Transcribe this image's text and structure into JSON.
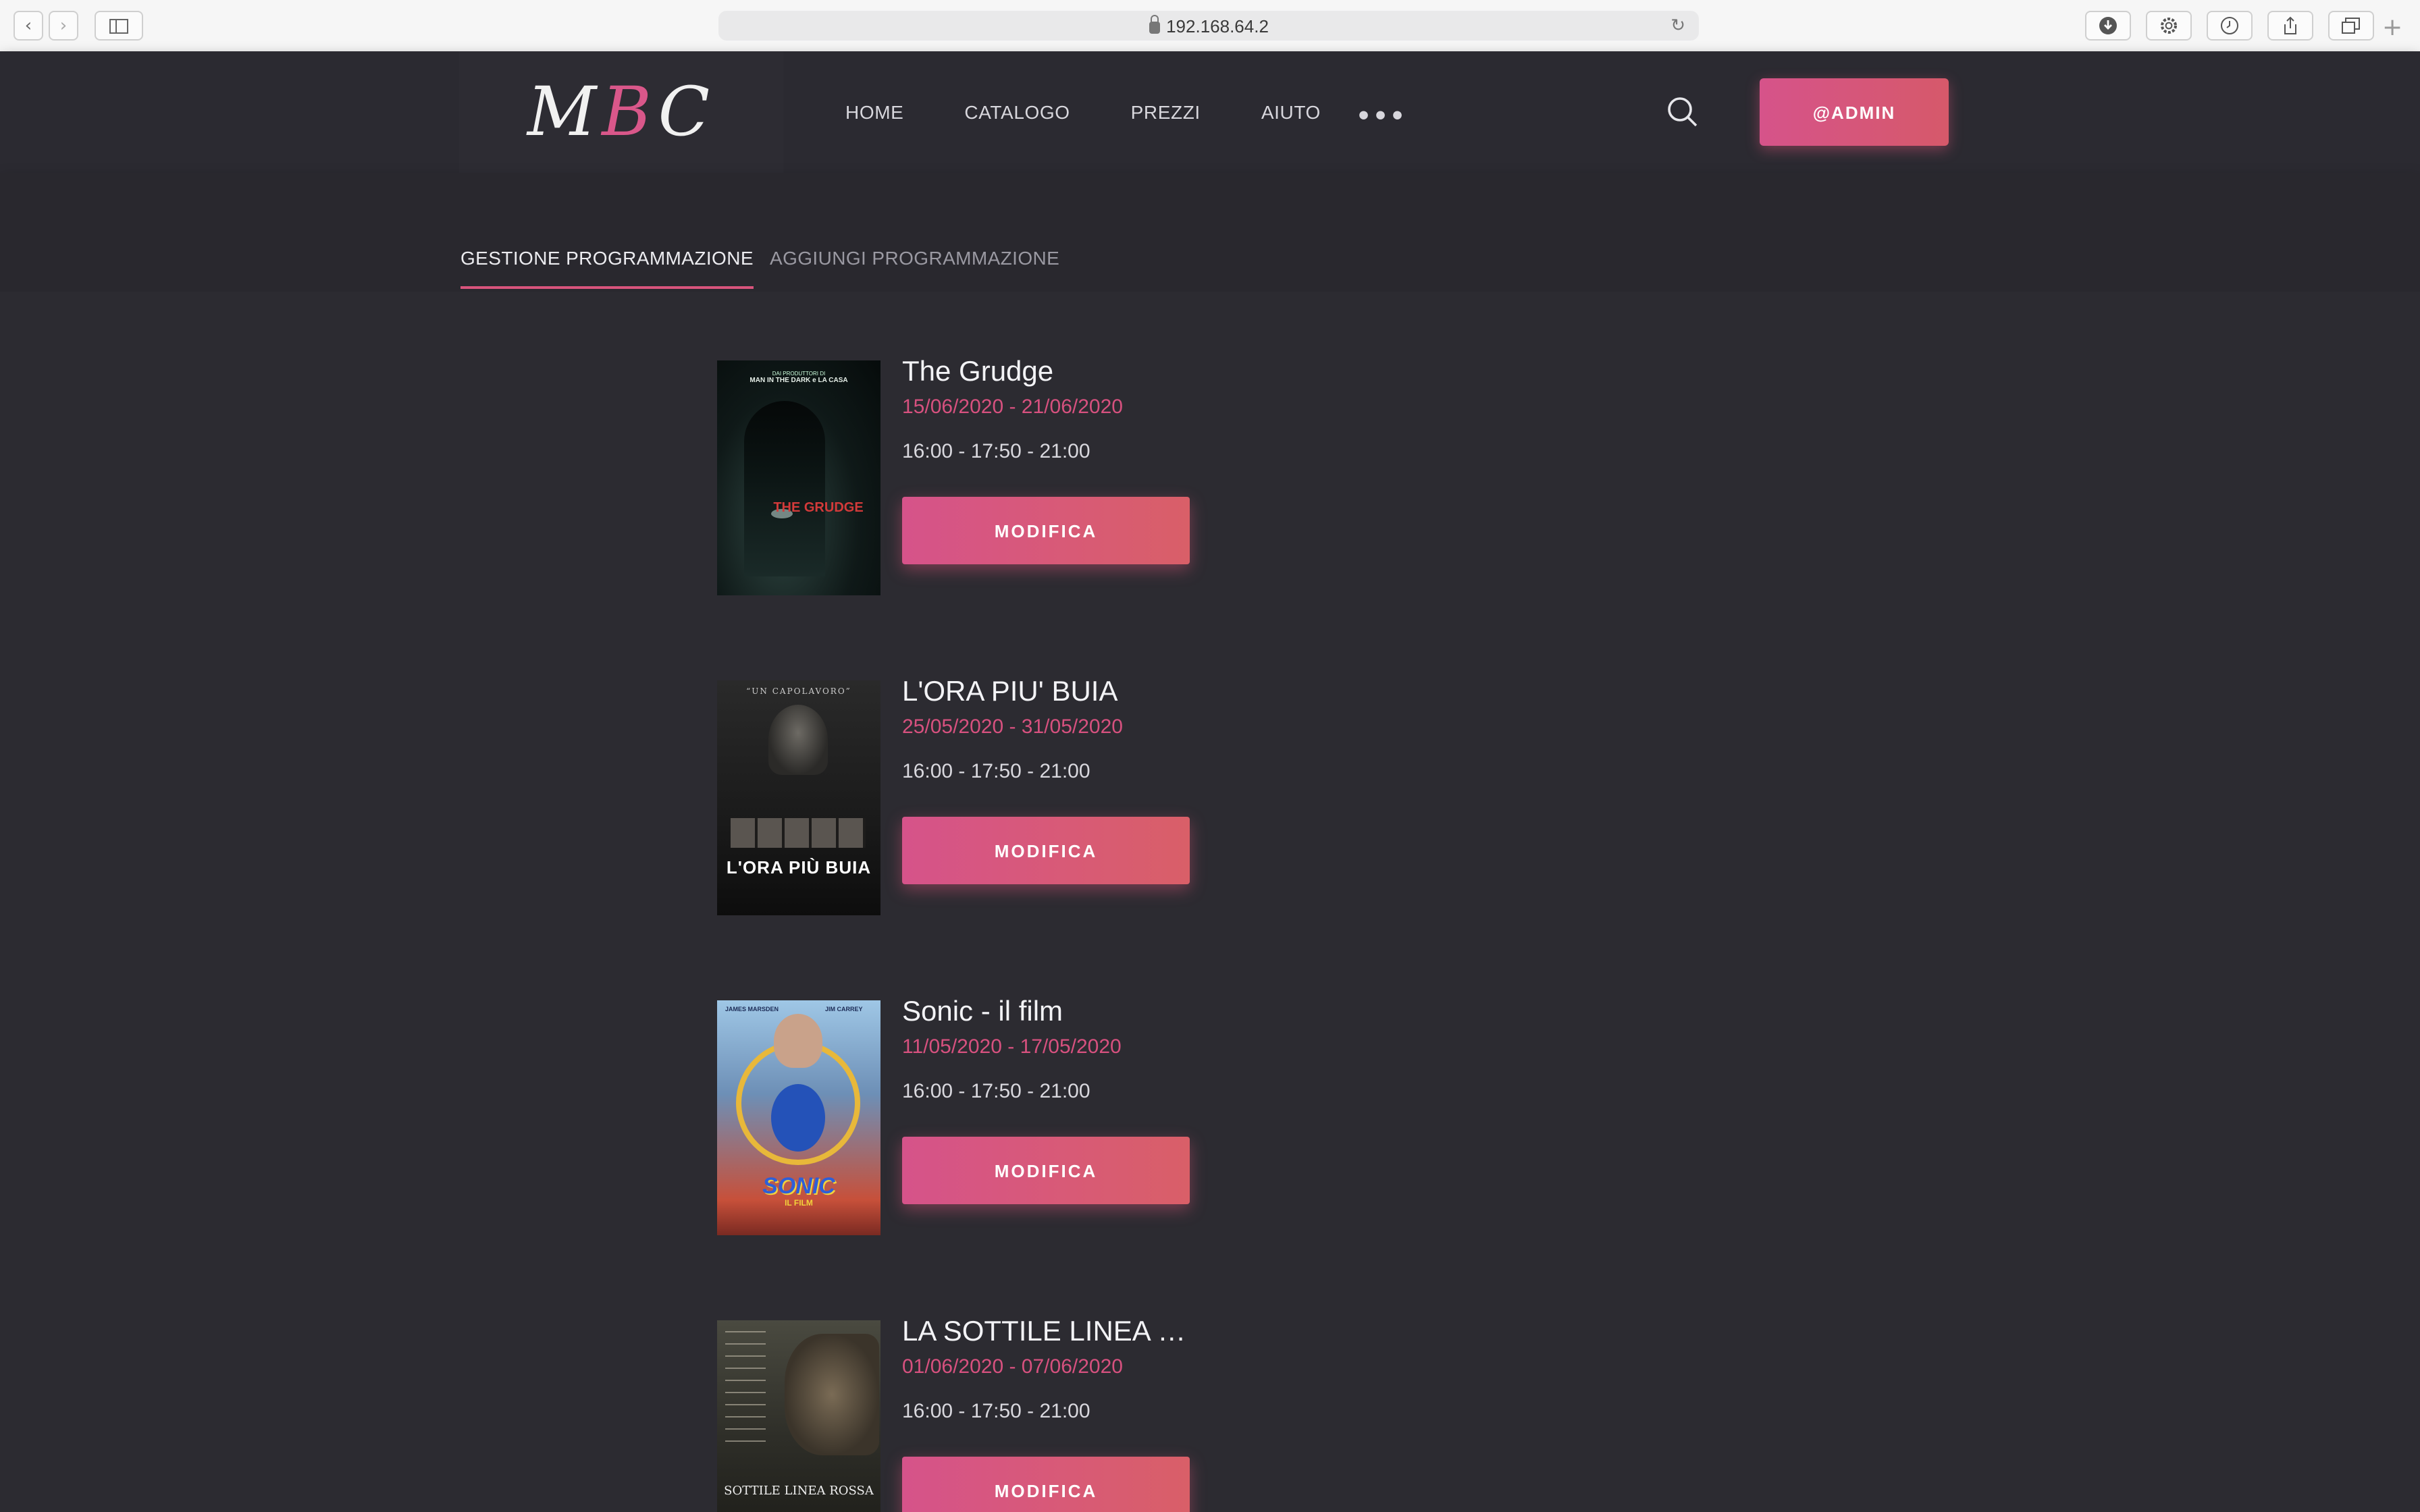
{
  "browser": {
    "url": "192.168.64.2"
  },
  "header": {
    "logo": {
      "m": "M",
      "b": "B",
      "c": "C"
    },
    "nav": [
      "HOME",
      "CATALOGO",
      "PREZZI",
      "AIUTO"
    ],
    "more": "•••",
    "user_button": "@ADMIN"
  },
  "tabs": [
    {
      "label": "GESTIONE PROGRAMMAZIONE",
      "active": true
    },
    {
      "label": "AGGIUNGI PROGRAMMAZIONE",
      "active": false
    }
  ],
  "schedules": [
    {
      "title": "The Grudge",
      "dates": "15/06/2020 - 21/06/2020",
      "times": "16:00 - 17:50 - 21:00",
      "button": "MODIFICA",
      "poster": {
        "top": "DAI PRODUTTORI DI",
        "tag": "MAN IN THE DARK e LA CASA",
        "name": "THE GRUDGE"
      }
    },
    {
      "title": "L'ORA PIU' BUIA",
      "dates": "25/05/2020 - 31/05/2020",
      "times": "16:00 - 17:50 - 21:00",
      "button": "MODIFICA",
      "poster": {
        "top": "“UN CAPOLAVORO”",
        "name": "L'ORA PIÙ BUIA"
      }
    },
    {
      "title": "Sonic - il film",
      "dates": "11/05/2020 - 17/05/2020",
      "times": "16:00 - 17:50 - 21:00",
      "button": "MODIFICA",
      "poster": {
        "left": "JAMES MARSDEN",
        "right": "JIM CARREY",
        "name": "SONIC",
        "sub": "IL FILM"
      }
    },
    {
      "title": "LA SOTTILE LINEA ROSSA",
      "dates": "01/06/2020 - 07/06/2020",
      "times": "16:00 - 17:50 - 21:00",
      "button": "MODIFICA",
      "poster": {
        "name": "SOTTILE LINEA ROSSA"
      }
    }
  ]
}
